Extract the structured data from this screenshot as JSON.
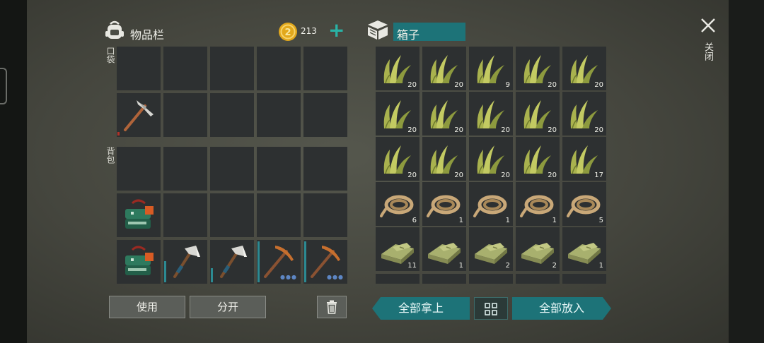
{
  "inventory": {
    "title": "物品栏",
    "pocket_label": "口袋",
    "backpack_label": "背包",
    "coins": "213",
    "add_coins": "+",
    "pocket_slots": [
      {
        "item": "",
        "count": ""
      },
      {
        "item": "",
        "count": ""
      },
      {
        "item": "",
        "count": ""
      },
      {
        "item": "",
        "count": ""
      },
      {
        "item": "",
        "count": ""
      },
      {
        "item": "pickaxe-stone",
        "count": ""
      },
      {
        "item": "",
        "count": ""
      },
      {
        "item": "",
        "count": ""
      },
      {
        "item": "",
        "count": ""
      },
      {
        "item": "",
        "count": ""
      }
    ],
    "backpack_slots": [
      {
        "item": "",
        "count": ""
      },
      {
        "item": "",
        "count": ""
      },
      {
        "item": "",
        "count": ""
      },
      {
        "item": "",
        "count": ""
      },
      {
        "item": "",
        "count": ""
      },
      {
        "item": "supply-crate",
        "count": ""
      },
      {
        "item": "",
        "count": ""
      },
      {
        "item": "",
        "count": ""
      },
      {
        "item": "",
        "count": ""
      },
      {
        "item": "",
        "count": ""
      },
      {
        "item": "supply-crate",
        "count": ""
      },
      {
        "item": "hatchet",
        "count": ""
      },
      {
        "item": "hatchet",
        "count": ""
      },
      {
        "item": "pickaxe-improved",
        "count": ""
      },
      {
        "item": "pickaxe-improved",
        "count": ""
      }
    ],
    "buttons": {
      "use": "使用",
      "split": "分开"
    }
  },
  "container": {
    "title": "箱子",
    "slots": [
      {
        "item": "plant-fiber",
        "count": "20"
      },
      {
        "item": "plant-fiber",
        "count": "20"
      },
      {
        "item": "plant-fiber",
        "count": "9"
      },
      {
        "item": "plant-fiber",
        "count": "20"
      },
      {
        "item": "plant-fiber",
        "count": "20"
      },
      {
        "item": "plant-fiber",
        "count": "20"
      },
      {
        "item": "plant-fiber",
        "count": "20"
      },
      {
        "item": "plant-fiber",
        "count": "20"
      },
      {
        "item": "plant-fiber",
        "count": "20"
      },
      {
        "item": "plant-fiber",
        "count": "20"
      },
      {
        "item": "plant-fiber",
        "count": "20"
      },
      {
        "item": "plant-fiber",
        "count": "20"
      },
      {
        "item": "plant-fiber",
        "count": "20"
      },
      {
        "item": "plant-fiber",
        "count": "20"
      },
      {
        "item": "plant-fiber",
        "count": "17"
      },
      {
        "item": "rope",
        "count": "6"
      },
      {
        "item": "rope",
        "count": "1"
      },
      {
        "item": "rope",
        "count": "1"
      },
      {
        "item": "rope",
        "count": "1"
      },
      {
        "item": "rope",
        "count": "5"
      },
      {
        "item": "cloth",
        "count": "11"
      },
      {
        "item": "cloth",
        "count": "1"
      },
      {
        "item": "cloth",
        "count": "2"
      },
      {
        "item": "cloth",
        "count": "2"
      },
      {
        "item": "cloth",
        "count": "1"
      }
    ],
    "buttons": {
      "take_all": "全部拿上",
      "put_all": "全部放入"
    }
  },
  "close_label": "关闭",
  "colors": {
    "accent": "#1d7378",
    "coin": "#e2a81c",
    "durability": "#2c8a92",
    "durability_low": "#b23228"
  },
  "icons": [
    "backpack-icon",
    "coin-icon",
    "box-icon",
    "close-icon",
    "trash-icon",
    "sort-grid-icon"
  ]
}
